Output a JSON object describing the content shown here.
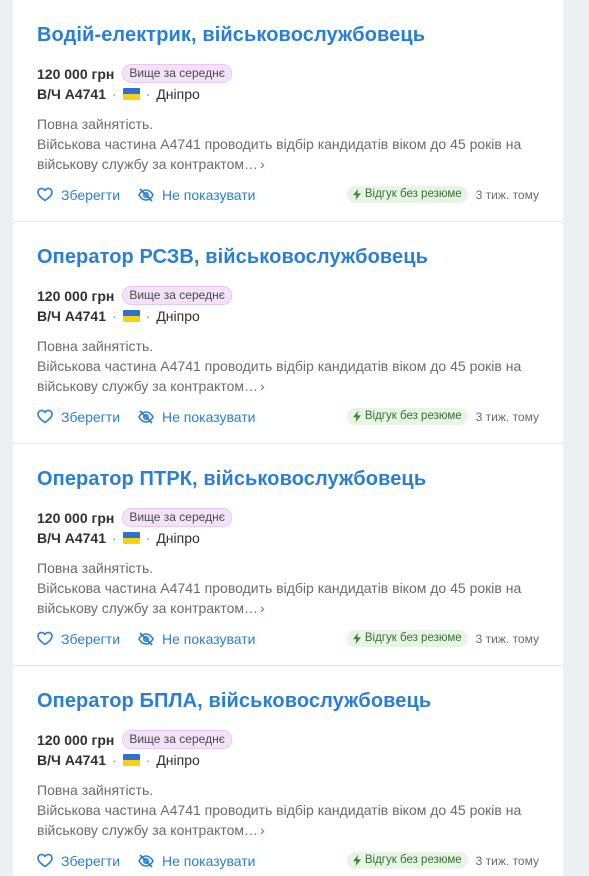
{
  "vacancies": [
    {
      "title": "Водій-електрик, військовослужбовець",
      "salary": "120 000 грн",
      "salary_badge": "Вище за середнє",
      "company": "В/Ч А4741",
      "separator": "·",
      "city": "Дніпро",
      "description_line1": "Повна зайнятість.",
      "description_text": "Військова частина А4741 проводить відбір кандидатів віком до 45 років на військову службу за контрактом…",
      "more_chevron": "›",
      "save_label": "Зберегти",
      "hide_label": "Не показувати",
      "quick_apply_label": "Відгук без резюме",
      "posted": "3 тиж. тому"
    },
    {
      "title": "Оператор РСЗВ, військовослужбовець",
      "salary": "120 000 грн",
      "salary_badge": "Вище за середнє",
      "company": "В/Ч А4741",
      "separator": "·",
      "city": "Дніпро",
      "description_line1": "Повна зайнятість.",
      "description_text": "Військова частина А4741 проводить відбір кандидатів віком до 45 років на військову службу за контрактом…",
      "more_chevron": "›",
      "save_label": "Зберегти",
      "hide_label": "Не показувати",
      "quick_apply_label": "Відгук без резюме",
      "posted": "3 тиж. тому"
    },
    {
      "title": "Оператор ПТРК, військовослужбовець",
      "salary": "120 000 грн",
      "salary_badge": "Вище за середнє",
      "company": "В/Ч А4741",
      "separator": "·",
      "city": "Дніпро",
      "description_line1": "Повна зайнятість.",
      "description_text": "Військова частина А4741 проводить відбір кандидатів віком до 45 років на військову службу за контрактом…",
      "more_chevron": "›",
      "save_label": "Зберегти",
      "hide_label": "Не показувати",
      "quick_apply_label": "Відгук без резюме",
      "posted": "3 тиж. тому"
    },
    {
      "title": "Оператор БПЛА, військовослужбовець",
      "salary": "120 000 грн",
      "salary_badge": "Вище за середнє",
      "company": "В/Ч А4741",
      "separator": "·",
      "city": "Дніпро",
      "description_line1": "Повна зайнятість.",
      "description_text": "Військова частина А4741 проводить відбір кандидатів віком до 45 років на військову службу за контрактом…",
      "more_chevron": "›",
      "save_label": "Зберегти",
      "hide_label": "Не показувати",
      "quick_apply_label": "Відгук без резюме",
      "posted": "3 тиж. тому"
    }
  ],
  "colors": {
    "link": "#2a7fd4",
    "badge_bg": "#f3e2f8",
    "quick_bg": "#e6f5e4",
    "flag_blue": "#2f6fd6",
    "flag_yellow": "#f5d310"
  },
  "icons": {
    "save": "heart-icon",
    "hide": "eye-off-icon",
    "quick_apply": "lightning-icon",
    "country": "ukraine-flag-icon"
  }
}
